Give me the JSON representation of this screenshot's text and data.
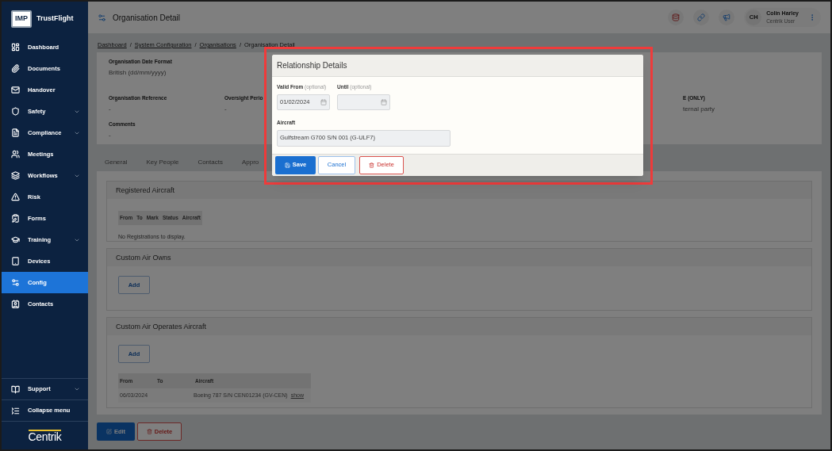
{
  "sidebar": {
    "logo_badge": "IMP",
    "brand": "TrustFlight",
    "items": [
      {
        "label": "Dashboard",
        "selected": false,
        "has_submenu": false
      },
      {
        "label": "Documents",
        "selected": false,
        "has_submenu": false
      },
      {
        "label": "Handover",
        "selected": false,
        "has_submenu": false
      },
      {
        "label": "Safety",
        "selected": false,
        "has_submenu": true
      },
      {
        "label": "Compliance",
        "selected": false,
        "has_submenu": true
      },
      {
        "label": "Meetings",
        "selected": false,
        "has_submenu": false
      },
      {
        "label": "Workflows",
        "selected": false,
        "has_submenu": true
      },
      {
        "label": "Risk",
        "selected": false,
        "has_submenu": false
      },
      {
        "label": "Forms",
        "selected": false,
        "has_submenu": false
      },
      {
        "label": "Training",
        "selected": false,
        "has_submenu": true
      },
      {
        "label": "Devices",
        "selected": false,
        "has_submenu": false
      },
      {
        "label": "Config",
        "selected": true,
        "has_submenu": false
      },
      {
        "label": "Contacts",
        "selected": false,
        "has_submenu": false
      }
    ],
    "footer_items": [
      {
        "label": "Support",
        "has_submenu": true
      },
      {
        "label": "Collapse menu",
        "has_submenu": false
      }
    ],
    "footer_logo": "Centrik"
  },
  "header": {
    "title": "Organisation Detail",
    "user": {
      "initials": "CH",
      "name": "Colin Harley",
      "role": "Centrik User"
    }
  },
  "breadcrumb": [
    {
      "label": "Dashboard",
      "link": true
    },
    {
      "separator": "/",
      "label": "System Configuration",
      "link": true
    },
    {
      "separator": "/",
      "label": "Organisations",
      "link": true
    },
    {
      "separator": "/",
      "label": "Organisation Detail",
      "link": false
    }
  ],
  "details": {
    "date_format_label": "Organisation Date Format",
    "date_format": "British (dd/mm/yyyy)",
    "reference_label": "Organisation Reference",
    "reference": "-",
    "oversight_label": "Oversight Perio",
    "oversight": "-",
    "comments_label": "Comments",
    "comments": "-",
    "column_4_label": "E (ONLY)",
    "column_4_value": "ternal party"
  },
  "tabs": [
    {
      "label": "General",
      "selected": false
    },
    {
      "label": "Key People",
      "selected": false
    },
    {
      "label": "Contacts",
      "selected": false
    },
    {
      "label": "Appro",
      "selected": false
    }
  ],
  "registered_aircraft": {
    "title": "Registered Aircraft",
    "columns": [
      "From",
      "To",
      "Mark",
      "Status",
      "Aircraft"
    ],
    "empty_message": "No Registrations to display."
  },
  "owns": {
    "title": "Custom Air Owns",
    "add_button": "Add"
  },
  "operates": {
    "title": "Custom Air Operates Aircraft",
    "add_button": "Add",
    "columns": [
      "From",
      "To",
      "Aircraft"
    ],
    "rows": [
      {
        "from": "06/03/2024",
        "aircraft": "Boeing 787 S/N CEN01234 (GV-CEN)",
        "link": "show"
      }
    ]
  },
  "actions": {
    "edit": "Edit",
    "delete": "Delete"
  },
  "modal": {
    "title": "Relationship Details",
    "valid_from": {
      "label": "Valid From",
      "hint": "(optional)",
      "value": "01/02/2024"
    },
    "until": {
      "label": "Until",
      "hint": "(optional)"
    },
    "aircraft": {
      "label": "Aircraft",
      "value": "Gulfstream G700 S/N 001 (G-ULF7)"
    },
    "save": "Save",
    "cancel": "Cancel",
    "delete": "Delete"
  }
}
